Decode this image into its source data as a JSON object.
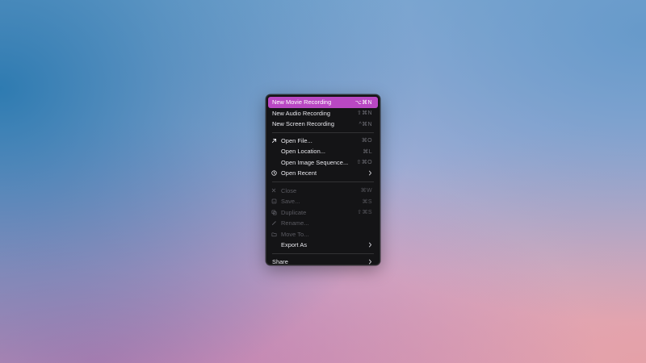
{
  "menu": {
    "recording_group": [
      {
        "label": "New Movie Recording",
        "shortcut": "⌥⌘N",
        "highlighted": true
      },
      {
        "label": "New Audio Recording",
        "shortcut": "⇧⌘N"
      },
      {
        "label": "New Screen Recording",
        "shortcut": "^⌘N"
      }
    ],
    "open_group": [
      {
        "label": "Open File...",
        "shortcut": "⌘O",
        "icon": "arrow-up-right-icon"
      },
      {
        "label": "Open Location...",
        "shortcut": "⌘L"
      },
      {
        "label": "Open Image Sequence...",
        "shortcut": "⇧⌘O"
      },
      {
        "label": "Open Recent",
        "icon": "clock-icon",
        "submenu": true
      }
    ],
    "file_group": [
      {
        "label": "Close",
        "shortcut": "⌘W",
        "icon": "close-icon",
        "disabled": true
      },
      {
        "label": "Save...",
        "shortcut": "⌘S",
        "icon": "save-icon",
        "disabled": true
      },
      {
        "label": "Duplicate",
        "shortcut": "⇧⌘S",
        "icon": "duplicate-icon",
        "disabled": true
      },
      {
        "label": "Rename...",
        "icon": "pencil-icon",
        "disabled": true
      },
      {
        "label": "Move To...",
        "icon": "folder-icon",
        "disabled": true
      },
      {
        "label": "Export As",
        "submenu": true
      }
    ],
    "share_group": [
      {
        "label": "Share",
        "submenu": true
      }
    ],
    "colors": {
      "background": "#141416",
      "highlight": "#b948c3",
      "text": "#e9e9ee",
      "disabled_text": "#5b5b62"
    }
  }
}
